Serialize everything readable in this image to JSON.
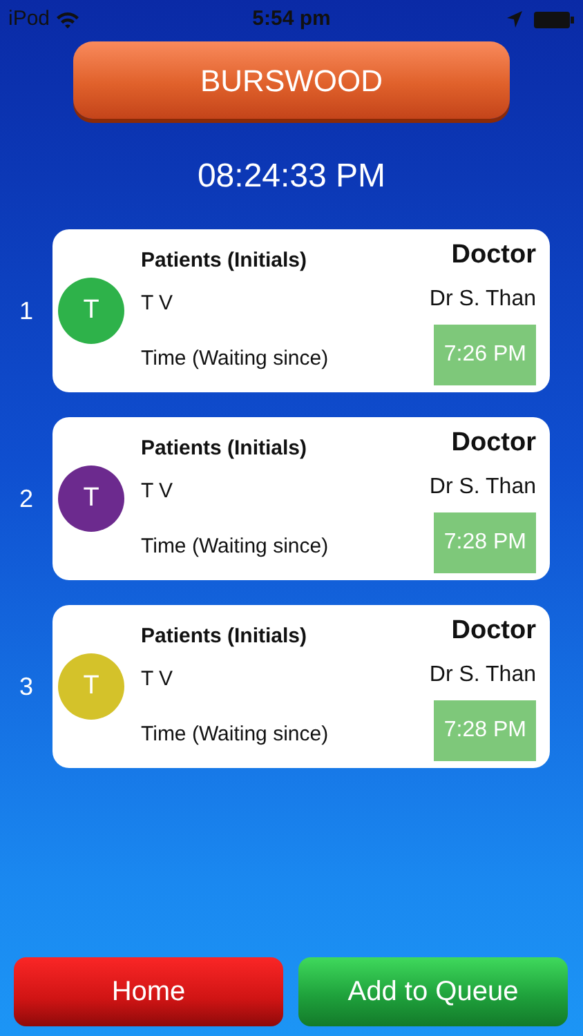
{
  "status_bar": {
    "carrier": "iPod",
    "time": "5:54 pm"
  },
  "location_button": "BURSWOOD",
  "clock": "08:24:33 PM",
  "queue": [
    {
      "number": "1",
      "initial": "T",
      "color": "#2eb24a",
      "patient_label": "Patients (Initials)",
      "patient": "T V",
      "time_label": "Time (Waiting since)",
      "doctor_label": "Doctor",
      "doctor": "Dr S. Than",
      "time": "7:26 PM"
    },
    {
      "number": "2",
      "initial": "T",
      "color": "#6c2a8e",
      "patient_label": "Patients (Initials)",
      "patient": "T V",
      "time_label": "Time (Waiting since)",
      "doctor_label": "Doctor",
      "doctor": "Dr S. Than",
      "time": "7:28 PM"
    },
    {
      "number": "3",
      "initial": "T",
      "color": "#d4c22a",
      "patient_label": "Patients (Initials)",
      "patient": "T V",
      "time_label": "Time (Waiting since)",
      "doctor_label": "Doctor",
      "doctor": "Dr S. Than",
      "time": "7:28 PM"
    }
  ],
  "buttons": [
    {
      "label": "Home",
      "kind": "home"
    },
    {
      "label": "Add to Queue",
      "kind": "add"
    }
  ]
}
